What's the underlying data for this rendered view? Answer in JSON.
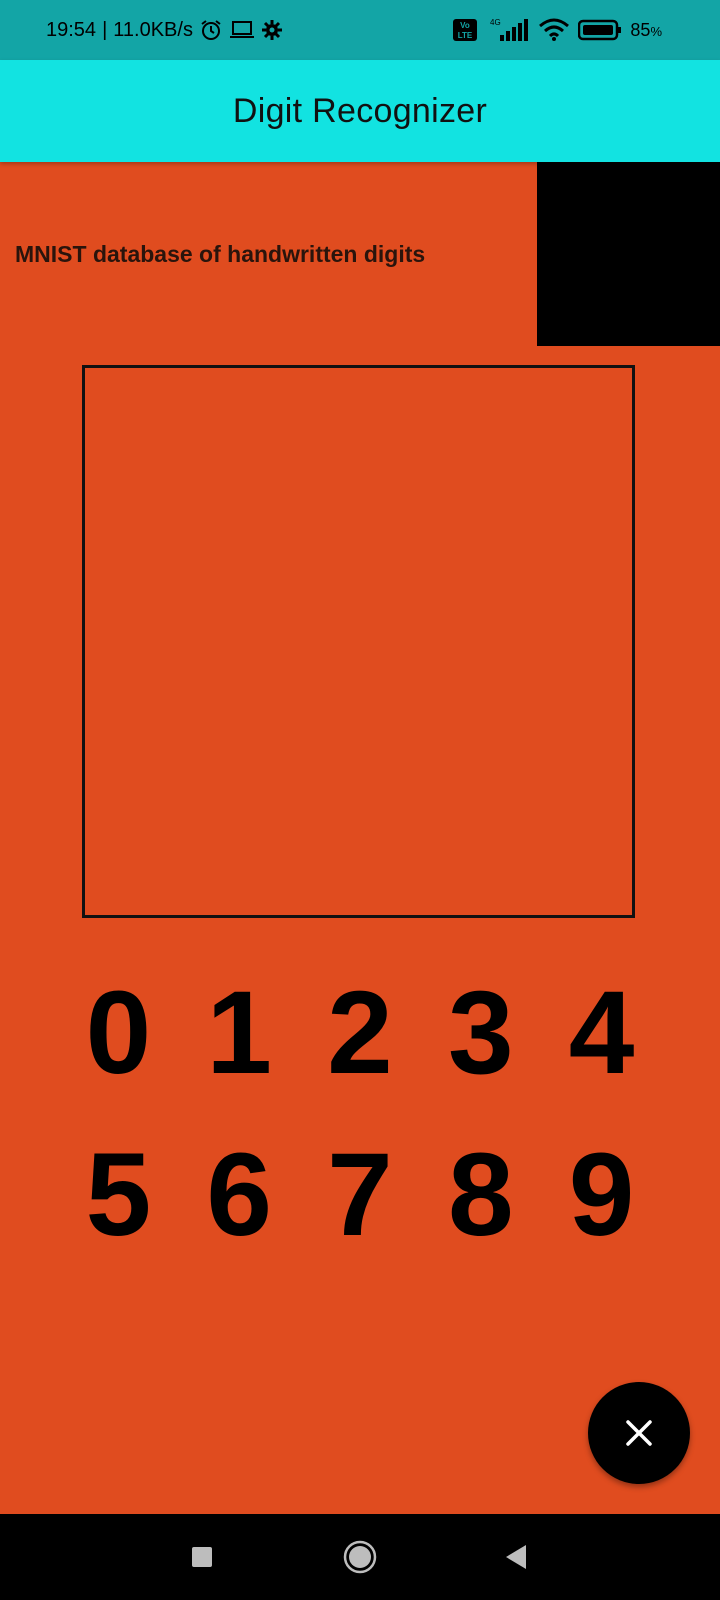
{
  "status_bar": {
    "time": "19:54",
    "separator": "|",
    "speed": "11.0KB/s",
    "icons_left": [
      "alarm-icon",
      "laptop-icon",
      "gear-icon"
    ],
    "network_badge": "Vo LTE",
    "network_type": "4G",
    "battery_percent": "85",
    "battery_unit": "%"
  },
  "app_bar": {
    "title": "Digit Recognizer"
  },
  "main": {
    "subtitle": "MNIST database of handwritten digits",
    "digits": [
      "0",
      "1",
      "2",
      "3",
      "4",
      "5",
      "6",
      "7",
      "8",
      "9"
    ]
  },
  "fab": {
    "icon": "close-icon"
  },
  "nav_bar": {
    "buttons": [
      "recents-square-icon",
      "home-circle-icon",
      "back-triangle-icon"
    ]
  },
  "colors": {
    "status_bar_bg": "#13a5a6",
    "app_bar_bg": "#12e3e1",
    "main_bg": "#e04c1f",
    "preview_bg": "#000000",
    "fab_bg": "#000000"
  }
}
